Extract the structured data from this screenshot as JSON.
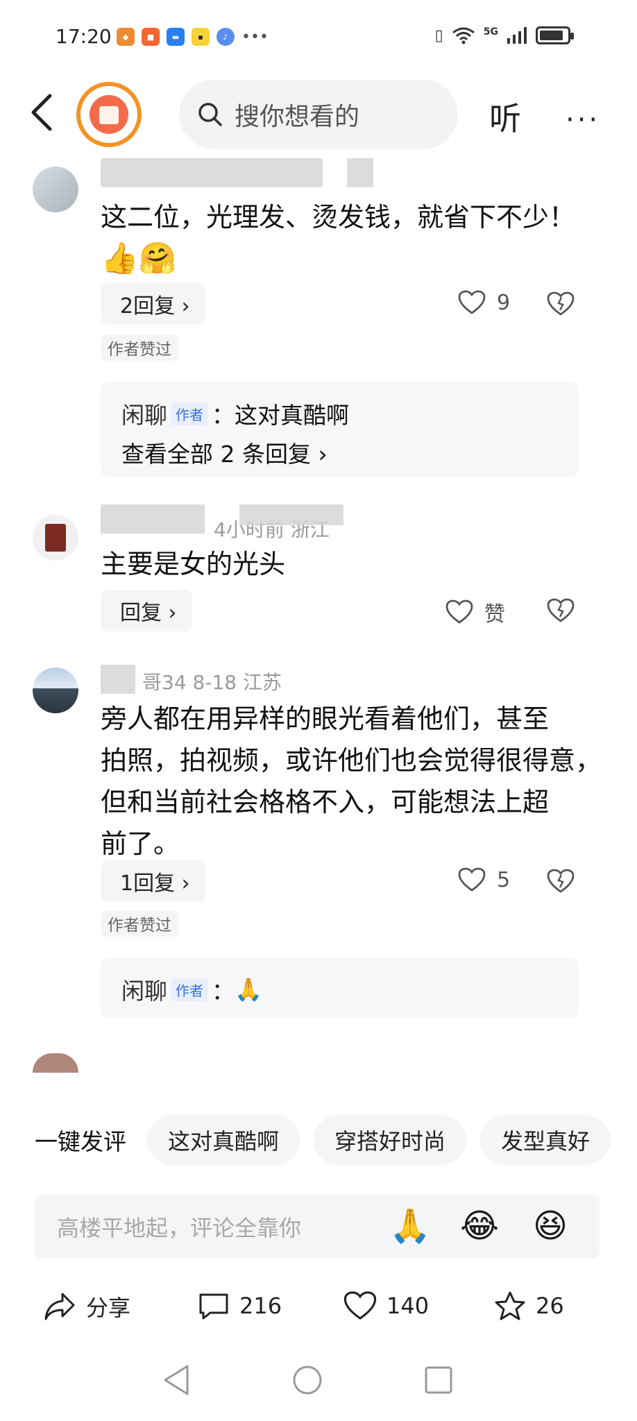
{
  "status_bar": {
    "time": "17:20",
    "network": "5G"
  },
  "header": {
    "search_placeholder": "搜你想看的",
    "listen_label": "听",
    "more_label": "···"
  },
  "comments": [
    {
      "meta": "",
      "body_lines": [
        "这二位，光理发、烫发钱，就省下不少！"
      ],
      "reply_label": "2回复 ›",
      "like_count": "9",
      "author_liked": "作者赞过",
      "sub_reply": {
        "name": "闲聊",
        "tag": "作者",
        "text": "：这对真酷啊",
        "view_all": "查看全部 2 条回复 ›"
      }
    },
    {
      "meta": "4小时前  浙江",
      "body_lines": [
        "主要是女的光头"
      ],
      "reply_label": "回复 ›",
      "like_count": "赞"
    },
    {
      "meta": "哥34  8-18  江苏",
      "body_lines": [
        "旁人都在用异样的眼光看着他们，甚至",
        "拍照，拍视频，或许他们也会觉得很得意，",
        "但和当前社会格格不入，可能想法上超",
        "前了。"
      ],
      "reply_label": "1回复 ›",
      "like_count": "5",
      "author_liked": "作者赞过",
      "sub_reply": {
        "name": "闲聊",
        "tag": "作者",
        "text": "："
      }
    }
  ],
  "quick_reply": {
    "label": "一键发评",
    "chips": [
      "这对真酷啊",
      "穿搭好时尚",
      "发型真好"
    ]
  },
  "comment_input": {
    "placeholder": "高楼平地起，评论全靠你"
  },
  "actions": {
    "share_label": "分享",
    "comment_count": "216",
    "like_count": "140",
    "favorite_count": "26"
  }
}
